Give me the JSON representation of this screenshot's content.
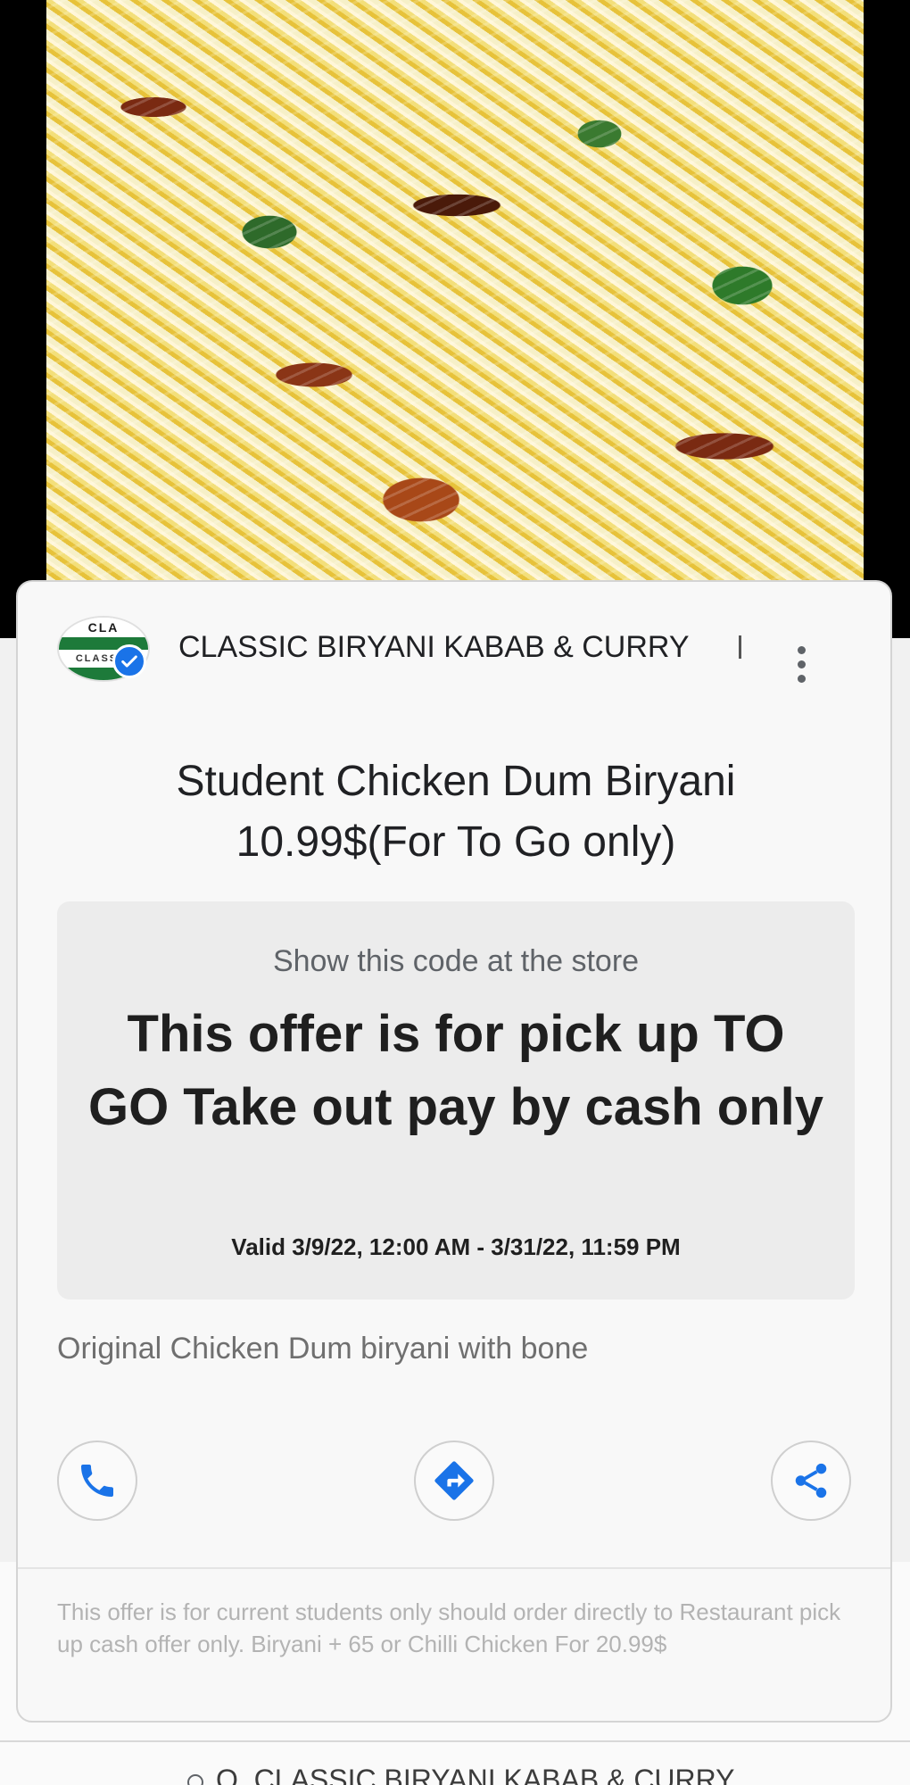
{
  "business": {
    "name": "CLASSIC BIRYANI KABAB & CURRY",
    "logo_text_top": "CLA",
    "logo_text_bottom": "CLASSIC"
  },
  "offer": {
    "title": "Student Chicken Dum Biryani 10.99$(For To Go only)",
    "code_hint": "Show this code at the store",
    "code": "This offer is for pick up TO GO Take out pay by cash only",
    "validity": "Valid 3/9/22, 12:00 AM - 3/31/22, 11:59 PM",
    "description": "Original Chicken Dum biryani with bone",
    "terms": "This offer is for current students only should order directly to Restaurant pick up cash offer only. Biryani + 65 or Chilli Chicken For 20.99$"
  },
  "actions": {
    "call_icon": "phone-icon",
    "directions_icon": "directions-icon",
    "share_icon": "share-icon"
  },
  "footer": {
    "address": "Q, CLASSIC BIRYANI KABAB & CURRY"
  },
  "colors": {
    "accent": "#1a73e8",
    "text": "#202124",
    "muted": "#6f6f6f"
  }
}
